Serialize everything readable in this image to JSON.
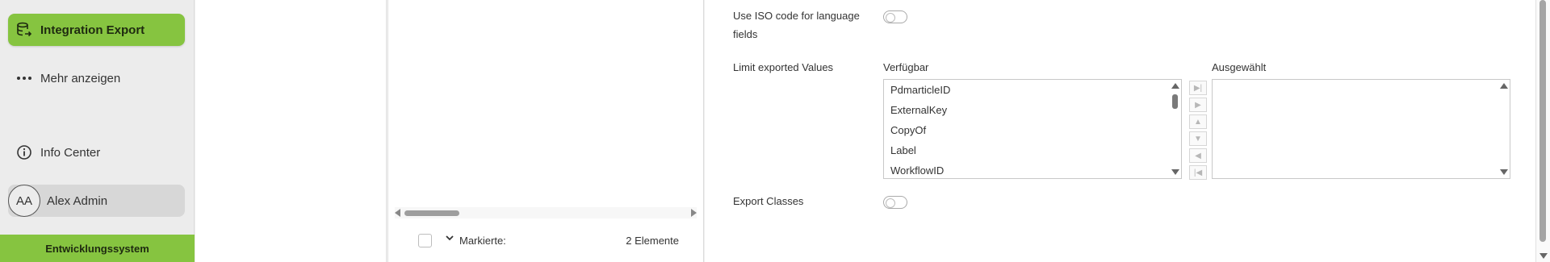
{
  "sidebar": {
    "items": [
      {
        "label": "Integration Export",
        "icon": "database-export-icon",
        "active": true
      },
      {
        "label": "Mehr anzeigen",
        "icon": "more-dots-icon"
      },
      {
        "label": "Info Center",
        "icon": "info-icon"
      }
    ],
    "user": {
      "initials": "AA",
      "name": "Alex Admin"
    },
    "environment": "Entwicklungssystem"
  },
  "list": {
    "footer": {
      "marked_label": "Markierte:",
      "count_label": "2 Elemente"
    }
  },
  "form": {
    "iso_label_line1": "Use ISO code for language",
    "iso_label_line2": "fields",
    "limit_label": "Limit exported Values",
    "available_header": "Verfügbar",
    "selected_header": "Ausgewählt",
    "available_items": [
      "PdmarticleID",
      "ExternalKey",
      "CopyOf",
      "Label",
      "WorkflowID"
    ],
    "selected_items": [],
    "export_classes_label": "Export Classes",
    "toggles": {
      "use_iso": false,
      "export_classes": false
    }
  },
  "colors": {
    "accent": "#86c440"
  }
}
